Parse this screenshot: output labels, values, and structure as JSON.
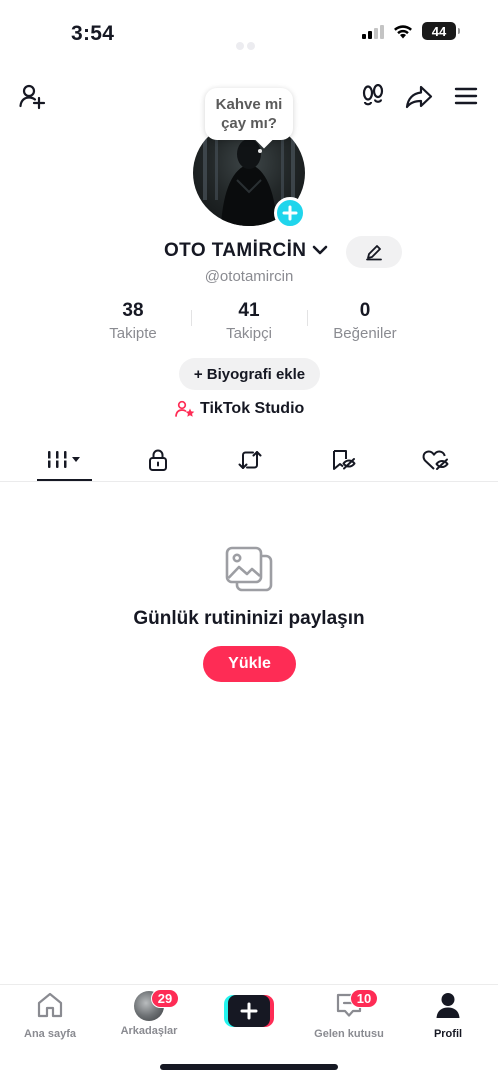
{
  "status_bar": {
    "time": "3:54",
    "battery": "44"
  },
  "profile": {
    "bubble_text": "Kahve mi çay mı?",
    "display_name": "OTO TAMİRCİN",
    "username": "@ototamircin"
  },
  "stats": [
    {
      "value": "38",
      "label": "Takipte"
    },
    {
      "value": "41",
      "label": "Takipçi"
    },
    {
      "value": "0",
      "label": "Beğeniler"
    }
  ],
  "actions": {
    "bio_label": "+ Biyografi ekle",
    "studio_label": "TikTok Studio"
  },
  "tabs": [
    "videos-grid",
    "private",
    "reposts",
    "favorites",
    "liked"
  ],
  "empty_state": {
    "title": "Günlük rutininizi paylaşın",
    "button_label": "Yükle"
  },
  "bottom_nav": {
    "home": "Ana sayfa",
    "friends": "Arkadaşlar",
    "friends_badge": "29",
    "inbox": "Gelen kutusu",
    "inbox_badge": "10",
    "profile": "Profil"
  },
  "colors": {
    "accent_red": "#fe2c55",
    "accent_cyan": "#20d5ec",
    "text_primary": "#161823",
    "text_secondary": "#8a8b91"
  }
}
